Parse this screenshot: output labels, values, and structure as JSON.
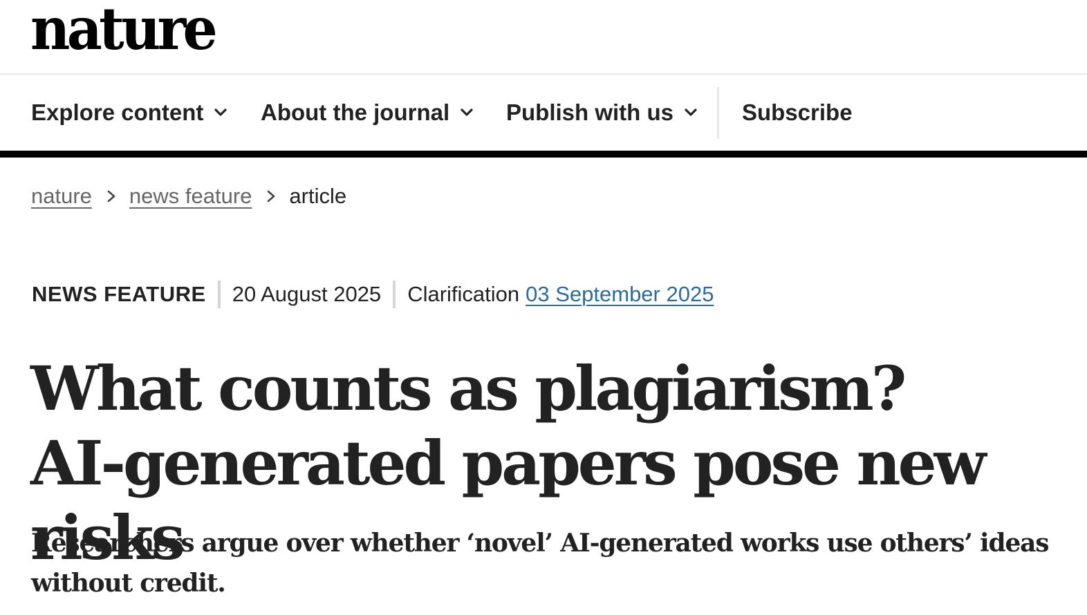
{
  "site": {
    "logo_text": "nature"
  },
  "nav": {
    "items": [
      {
        "label": "Explore content",
        "has_dropdown": true
      },
      {
        "label": "About the journal",
        "has_dropdown": true
      },
      {
        "label": "Publish with us",
        "has_dropdown": true
      }
    ],
    "subscribe_label": "Subscribe"
  },
  "breadcrumb": {
    "items": [
      "nature",
      "news feature"
    ],
    "current": "article"
  },
  "article": {
    "type": "NEWS FEATURE",
    "published_date": "20 August 2025",
    "clarification_label": "Clarification",
    "clarification_date": "03 September 2025",
    "title": "What counts as plagiarism? AI-generated papers pose new risks",
    "standfirst": "Researchers argue over whether ‘novel’ AI-generated works use others’ ideas without credit."
  },
  "colors": {
    "text": "#222222",
    "link_blue": "#2b6ba0",
    "rule": "#000000",
    "divider": "#e7e7e7"
  },
  "icons": {
    "nav_dropdown": "chevron-down-icon",
    "breadcrumb_separator": "chevron-right-icon"
  }
}
